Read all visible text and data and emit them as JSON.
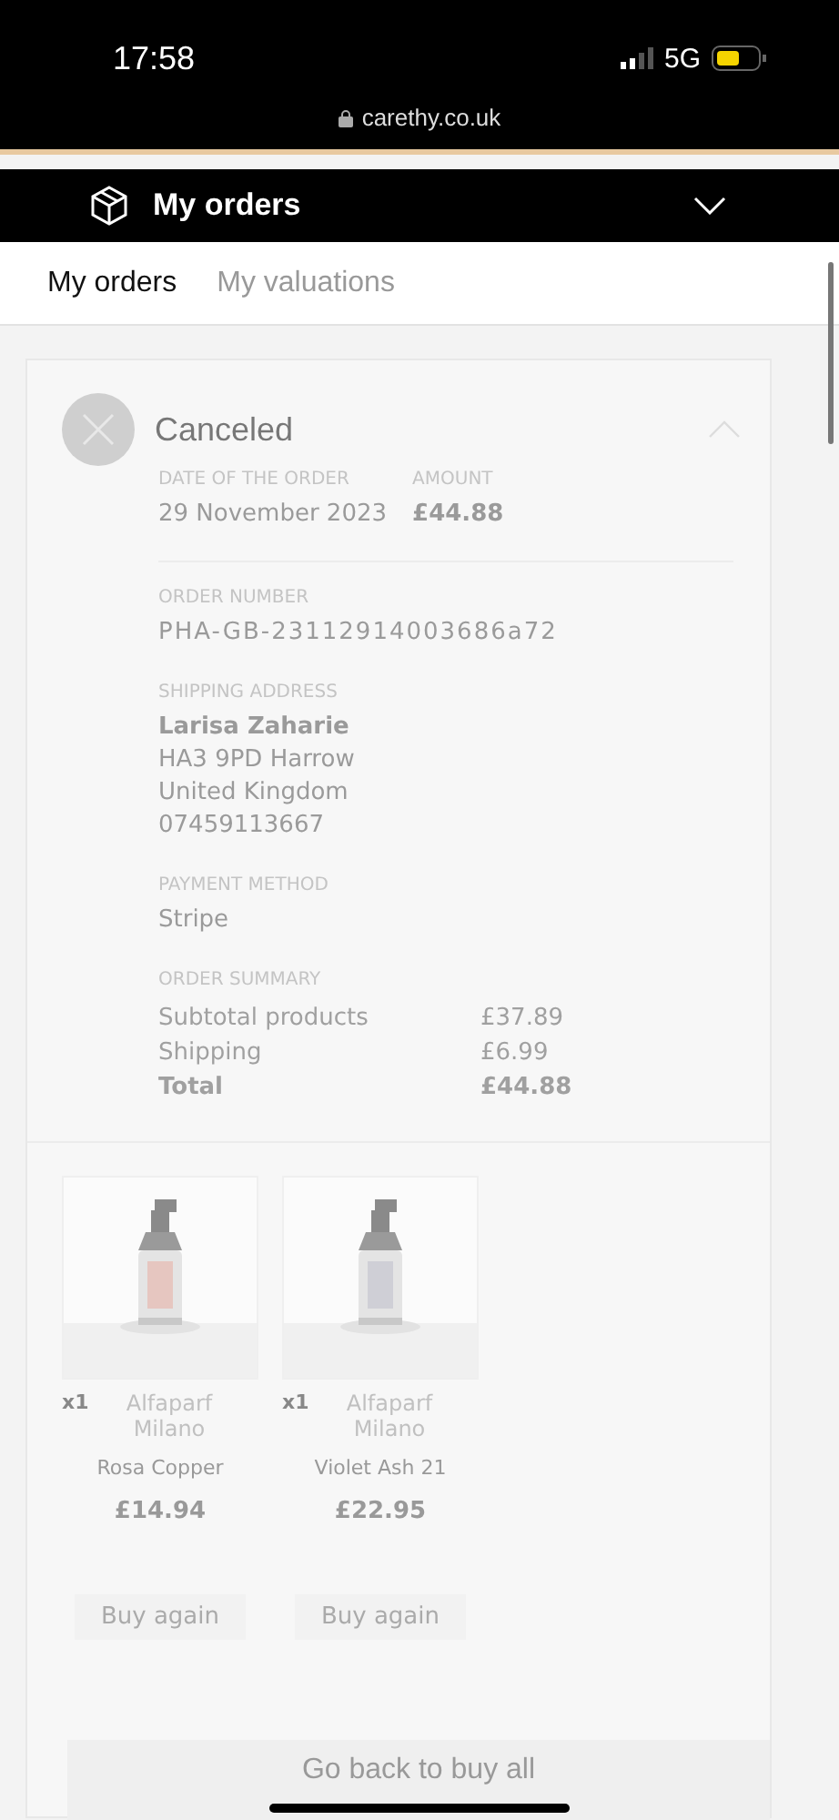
{
  "status_bar": {
    "time": "17:58",
    "network": "5G"
  },
  "browser": {
    "url": "carethy.co.uk"
  },
  "header": {
    "title": "My orders"
  },
  "tabs": [
    {
      "label": "My orders",
      "selected": true
    },
    {
      "label": "My valuations",
      "selected": false
    }
  ],
  "order": {
    "status": "Canceled",
    "expanded": true,
    "date_label": "DATE OF THE ORDER",
    "date": "29 November 2023",
    "amount_label": "AMOUNT",
    "amount": "£44.88",
    "number_label": "ORDER NUMBER",
    "number": "PHA-GB-23112914003686a72",
    "address_label": "SHIPPING ADDRESS",
    "address_name": "Larisa Zaharie",
    "address_lines": [
      "HA3 9PD Harrow",
      "United Kingdom",
      "07459113667"
    ],
    "payment_label": "PAYMENT METHOD",
    "payment": "Stripe",
    "summary_label": "ORDER SUMMARY",
    "summary": [
      {
        "label": "Subtotal products",
        "value": "£37.89",
        "kind": "line"
      },
      {
        "label": "Shipping",
        "value": "£6.99",
        "kind": "line"
      },
      {
        "label": "Total",
        "value": "£44.88",
        "kind": "total"
      }
    ],
    "products": [
      {
        "quantity": "x1",
        "brand": "Alfaparf Milano",
        "name": "Rosa Copper",
        "price": "£14.94",
        "button": "Buy again",
        "kind": "picture"
      },
      {
        "quantity": "x1",
        "brand": "Alfaparf Milano",
        "name": "Violet Ash 21",
        "price": "£22.95",
        "button": "Buy again",
        "kind": "picture"
      }
    ],
    "footer_button": "Go back to buy all"
  }
}
